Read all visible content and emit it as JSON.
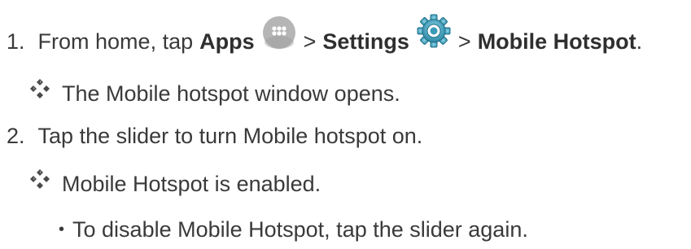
{
  "step1": {
    "number": "1.",
    "prefix": "From home, tap",
    "apps": "Apps",
    "sep1": ">",
    "settings": "Settings",
    "sep2": ">",
    "hotspot": "Mobile Hotspot",
    "end": "."
  },
  "result1": "The Mobile hotspot window opens.",
  "step2": {
    "number": "2.",
    "text": "Tap the slider to turn Mobile hotspot on."
  },
  "result2": "Mobile Hotspot is enabled.",
  "bullet": {
    "marker": "•",
    "text": "To disable Mobile Hotspot, tap the slider again."
  },
  "icons": {
    "apps": "apps-icon",
    "settings": "settings-gear-icon",
    "result": "diamond-bullet-icon"
  },
  "colors": {
    "text": "#3a3a3a",
    "apps_icon": "#b8b8b8",
    "gear": "#2c8ba8"
  }
}
